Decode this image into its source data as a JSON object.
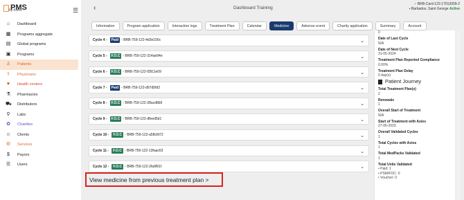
{
  "app": {
    "name": "PMS",
    "sub": "by Axios"
  },
  "nav": [
    {
      "label": "Dashboard",
      "icon": "home-icon",
      "glyph": "⌂",
      "active": false,
      "color": ""
    },
    {
      "label": "Programs aggregate",
      "icon": "grid-icon",
      "glyph": "▦",
      "active": false,
      "color": ""
    },
    {
      "label": "Global programs",
      "icon": "list-icon",
      "glyph": "▤",
      "active": false,
      "color": ""
    },
    {
      "label": "Programs",
      "icon": "folder-icon",
      "glyph": "▣",
      "active": false,
      "color": ""
    },
    {
      "label": "Patients",
      "icon": "patient-icon",
      "glyph": "♙",
      "active": true,
      "color": "orange"
    },
    {
      "label": "Physicians",
      "icon": "physician-icon",
      "glyph": "⚕",
      "active": false,
      "color": "orange"
    },
    {
      "label": "Health centers",
      "icon": "heart-icon",
      "glyph": "♥",
      "active": false,
      "color": "red"
    },
    {
      "label": "Pharmacies",
      "icon": "pill-icon",
      "glyph": "⚗",
      "active": false,
      "color": ""
    },
    {
      "label": "Distributors",
      "icon": "truck-icon",
      "glyph": "⛟",
      "active": false,
      "color": ""
    },
    {
      "label": "Labs",
      "icon": "lab-icon",
      "glyph": "⚲",
      "active": false,
      "color": ""
    },
    {
      "label": "Charities",
      "icon": "charity-icon",
      "glyph": "✿",
      "active": false,
      "color": "purple"
    },
    {
      "label": "Clients",
      "icon": "clients-icon",
      "glyph": "☺",
      "active": false,
      "color": ""
    },
    {
      "label": "Services",
      "icon": "services-icon",
      "glyph": "⚙",
      "active": false,
      "color": "orange"
    },
    {
      "label": "Payors",
      "icon": "payor-icon",
      "glyph": "$",
      "active": false,
      "color": ""
    },
    {
      "label": "Users",
      "icon": "users-icon",
      "glyph": "☰",
      "active": false,
      "color": ""
    }
  ],
  "header": {
    "title": "Dashboard Training",
    "card_id": "BRB-Card-122-17013009-2",
    "location": "Barbados, Saint George",
    "status": "Active"
  },
  "tabs": [
    {
      "label": "Information",
      "selected": false
    },
    {
      "label": "Program application",
      "selected": false
    },
    {
      "label": "Interaction logs",
      "selected": false
    },
    {
      "label": "Treatment Plan",
      "selected": false
    },
    {
      "label": "Calendar",
      "selected": false
    },
    {
      "label": "Medicine",
      "selected": true
    },
    {
      "label": "Adverse event",
      "selected": false
    },
    {
      "label": "Charity application",
      "selected": false
    },
    {
      "label": "Summary",
      "selected": false
    },
    {
      "label": "Account",
      "selected": false
    }
  ],
  "cycles": [
    {
      "label": "Cycle 4 -",
      "badge": "Paid",
      "code": "- BRB-759-122-4d3e156c"
    },
    {
      "label": "Cycle 5 -",
      "badge": "F.O.C",
      "code": "- BRB-759-122-314ae94e"
    },
    {
      "label": "Cycle 6 -",
      "badge": "F.O.C",
      "code": "- BRB-759-122-f2811e09"
    },
    {
      "label": "Cycle 7 -",
      "badge": "Paid",
      "code": "- BRB-759-122-d97d5fd2"
    },
    {
      "label": "Cycle 8 -",
      "badge": "F.O.C",
      "code": "- BRB-759-122-28acd8b9"
    },
    {
      "label": "Cycle 9 -",
      "badge": "F.O.C",
      "code": "- BRB-759-122-dfeed5d1"
    },
    {
      "label": "Cycle 10 -",
      "badge": "F.O.C",
      "code": "- BRB-759-122-a58cfd72"
    },
    {
      "label": "Cycle 11 -",
      "badge": "F.O.C",
      "code": "- BRB-759-122-13faac63"
    },
    {
      "label": "Cycle 12 -",
      "badge": "F.O.C",
      "code": "- BRB-759-122-2fa9f91f"
    }
  ],
  "view_link": "View medicine from previous treatment plan  >",
  "right_panel": {
    "top": [
      {
        "label": "",
        "value": "0"
      },
      {
        "label": "Date of Last Cycle",
        "value": "N/A"
      },
      {
        "label": "Date of Next Cycle",
        "value": "31-05-2024"
      },
      {
        "label": "Treatment Plan Reported Compliance",
        "value": "0.00%"
      },
      {
        "label": "Treatment Plan Delay",
        "value": "0 day(s)"
      }
    ],
    "journey_title": "Patient Journey",
    "journey": [
      {
        "label": "Total Treatment Plan(s)",
        "value": "2"
      },
      {
        "label": "Renewals",
        "value": "1"
      },
      {
        "label": "Overall Start of Treatment",
        "value": "N/A"
      },
      {
        "label": "Start of Treatment with Axios",
        "value": "27-06-2023"
      },
      {
        "label": "Overall Validated Cycles",
        "value": "1"
      },
      {
        "label": "Total Cycles with Axios",
        "value": "1"
      },
      {
        "label": "Total MedPacks Validated",
        "value": "1"
      }
    ],
    "total_units_label": "Total Units Validated",
    "total_units": [
      "Paid: 1",
      "PSM/FOC: 0",
      "Voucher: 0"
    ]
  }
}
